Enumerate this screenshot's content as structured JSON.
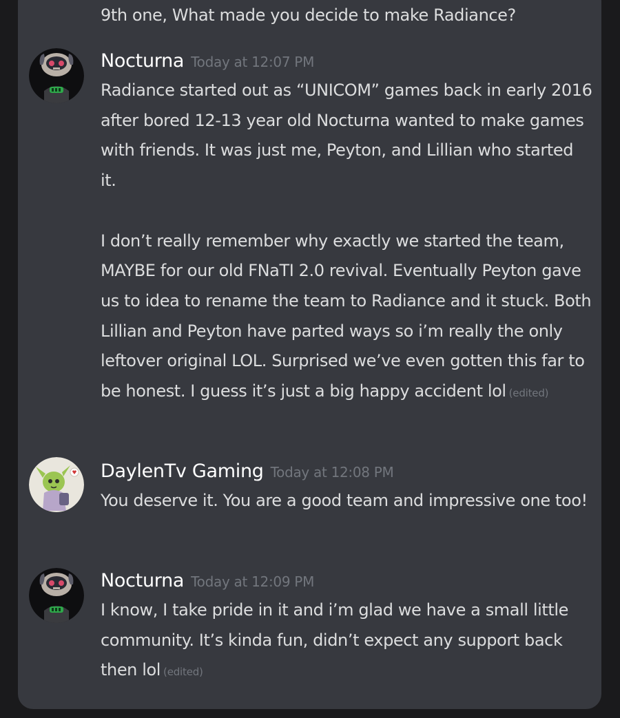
{
  "colors": {
    "background": "#1a1a1c",
    "panel": "#37393f",
    "author": "#ffffff",
    "text": "#dcddde",
    "muted": "#72767d"
  },
  "partial_message": {
    "text": "9th one, What made you decide to make Radiance?"
  },
  "messages": [
    {
      "author": "Nocturna",
      "timestamp": "Today at 12:07 PM",
      "avatar": "nocturna-avatar",
      "paragraphs": [
        "Radiance started out as “UNICOM” games back in early 2016 after bored 12-13 year old Nocturna wanted to make games with friends. It was just me, Peyton, and Lillian who started it.",
        "I don’t really remember why exactly we started the team, MAYBE for our old FNaTI 2.0 revival. Eventually Peyton gave us to idea to rename the team to Radiance and it stuck. Both Lillian and Peyton have parted ways so i’m really the only leftover original LOL. Surprised we’ve even gotten this far to be honest. I guess it’s just a big happy accident lol"
      ],
      "edited": "(edited)"
    },
    {
      "author": "DaylenTv Gaming",
      "timestamp": "Today at 12:08 PM",
      "avatar": "daylentv-avatar",
      "paragraphs": [
        "You deserve it. You are a good team and impressive one too!"
      ]
    },
    {
      "author": "Nocturna",
      "timestamp": "Today at 12:09 PM",
      "avatar": "nocturna-avatar",
      "paragraphs": [
        "I know, I take pride in it and i’m glad we have a small little community. It’s kinda fun, didn’t expect any support back then lol"
      ],
      "edited": "(edited)"
    }
  ]
}
